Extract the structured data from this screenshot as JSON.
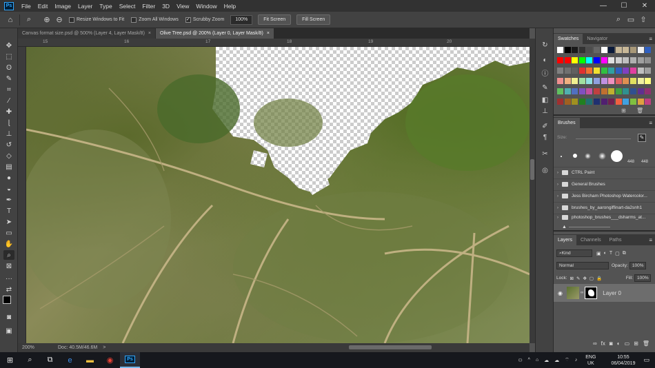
{
  "app": {
    "logo": "Ps"
  },
  "menu": [
    "File",
    "Edit",
    "Image",
    "Layer",
    "Type",
    "Select",
    "Filter",
    "3D",
    "View",
    "Window",
    "Help"
  ],
  "window_controls": {
    "minimize": "—",
    "maximize": "☐",
    "close": "✕"
  },
  "options": {
    "resize_windows": "Resize Windows to Fit",
    "zoom_all": "Zoom All Windows",
    "scrubby": "Scrubby Zoom",
    "zoom_value": "100%",
    "fit_screen": "Fit Screen",
    "fill_screen": "Fill Screen"
  },
  "tabs": [
    {
      "label": "Canvas format size.psd @ 500% (Layer 4, Layer Mask/8)",
      "close": "×"
    },
    {
      "label": "Olive Tree.psd @ 200% (Layer 0, Layer Mask/8)",
      "close": "×"
    }
  ],
  "ruler": {
    "marks": [
      "15",
      "16",
      "17",
      "18",
      "19",
      "20"
    ]
  },
  "status": {
    "zoom": "200%",
    "doc": "Doc: 40.5M/46.6M",
    "arrow": ">"
  },
  "swatches": {
    "tabs": [
      "Swatches",
      "Navigator"
    ],
    "menu": "≡"
  },
  "brushes": {
    "title": "Brushes",
    "size_label": "Size:",
    "preview_sizes": [
      "448",
      "448"
    ],
    "folders": [
      "CTRL Paint",
      "General Brushes",
      "Jess Bircham Photoshop Watercolor...",
      "brushes_by_aarongiffinart-da2snh1",
      "photoshop_brushes___dsharms_at..."
    ]
  },
  "layers": {
    "tabs": [
      "Layers",
      "Channels",
      "Paths"
    ],
    "kind": "Kind",
    "blend": "Normal",
    "opacity_label": "Opacity:",
    "opacity": "100%",
    "lock_label": "Lock:",
    "fill_label": "Fill:",
    "fill": "100%",
    "layer_name": "Layer 0"
  },
  "taskbar": {
    "lang": "ENG",
    "region": "UK",
    "time": "10:55",
    "date": "06/04/2019"
  }
}
